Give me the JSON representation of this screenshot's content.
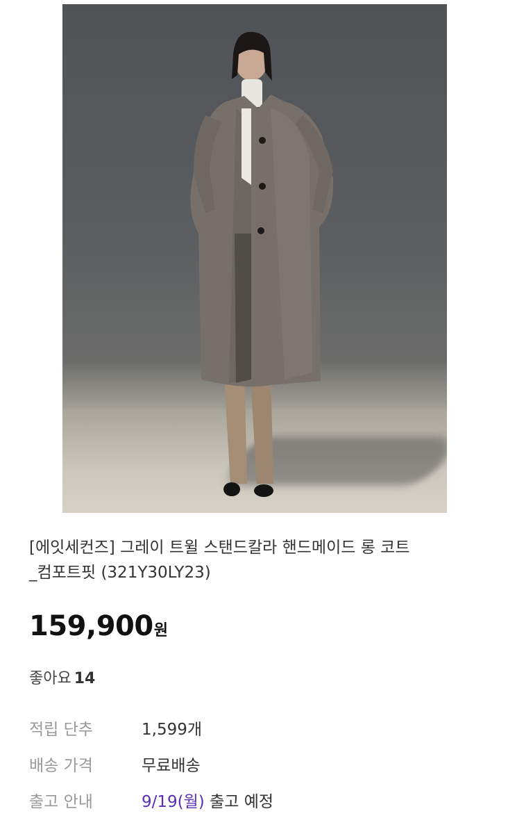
{
  "product": {
    "image_alt": "gray twill stand-collar handmade long coat model photo",
    "title_line1": "[에잇세컨즈] 그레이 트윌 스탠드칼라 핸드메이드 롱 코트",
    "title_line2": "_컴포트핏 (321Y30LY23)",
    "price": "159,900",
    "price_unit": "원",
    "likes_label": "좋아요",
    "likes_count": "14"
  },
  "info": {
    "points_label": "적립 단추",
    "points_value": "1,599개",
    "shipping_label": "배송 가격",
    "shipping_value": "무료배송",
    "release_label": "출고 안내",
    "release_date": "9/19(월)",
    "release_suffix": "출고 예정"
  },
  "colors": {
    "accent": "#5a2fb5",
    "label": "#999999",
    "text": "#333333"
  }
}
